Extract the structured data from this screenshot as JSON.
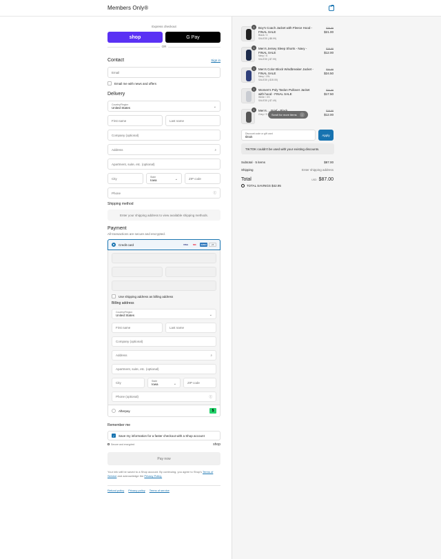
{
  "header": {
    "brand": "Members Only®"
  },
  "express": {
    "label": "Express checkout",
    "shop_pay": "shop",
    "gpay": "G Pay",
    "or": "OR"
  },
  "contact": {
    "heading": "Contact",
    "sign_in": "Sign in",
    "email_placeholder": "Email",
    "news_label": "Email me with news and offers"
  },
  "delivery": {
    "heading": "Delivery",
    "country_label": "Country/Region",
    "country_value": "United States",
    "first_name": "First name",
    "last_name": "Last name",
    "company": "Company (optional)",
    "address": "Address",
    "apartment": "Apartment, suite, etc. (optional)",
    "city": "City",
    "state_label": "State",
    "state_value": "Iowa",
    "zip": "ZIP code",
    "phone": "Phone"
  },
  "shipping": {
    "heading": "Shipping method",
    "notice": "Enter your shipping address to view available shipping methods."
  },
  "payment": {
    "heading": "Payment",
    "note": "All transactions are secure and encrypted.",
    "credit_card": "Credit card",
    "cards": [
      "VISA",
      "MC",
      "AMEX",
      "+5"
    ],
    "use_shipping": "Use shipping address as billing address",
    "billing_heading": "Billing address",
    "afterpay": "Afterpay"
  },
  "remember": {
    "heading": "Remember me",
    "save_label": "Save my information for a faster checkout with a Shop account",
    "secure": "Secure and encrypted",
    "shop": "shop"
  },
  "pay_now": "Pay now",
  "terms": {
    "text": "Your info will be saved to a Shop account. By continuing, you agree to Shop's",
    "tos": "Terms of Service",
    "mid": "and acknowledge the",
    "privacy": "Privacy Policy."
  },
  "footer": {
    "links": [
      "Refund policy",
      "Privacy policy",
      "Terms of service"
    ]
  },
  "cart": {
    "items": [
      {
        "qty": "1",
        "name": "Boy's Coach Jacket with Fleece Hood - FINAL SALE",
        "variant": "Black / 4",
        "discount": "SALE30 (-$8.99)",
        "original": "$29.99",
        "price": "$21.00",
        "color": "#222"
      },
      {
        "qty": "1",
        "name": "Men's Jersey Sleep Shorts - Navy - FINAL SALE",
        "variant": "Navy / S",
        "discount": "SALE30 (-$7.99)",
        "original": "$19.99",
        "price": "$12.00",
        "color": "#1d2b4a"
      },
      {
        "qty": "1",
        "name": "Men's Color Block Windbreaker Jacket - FINAL SALE",
        "variant": "Navy / 2XL",
        "discount": "SALE30 (-$15.00)",
        "original": "$34.99",
        "price": "$24.50",
        "color": "#2f3f7a"
      },
      {
        "qty": "1",
        "name": "Women's Poly Taslon Pullover Jacket with hood - FINAL SALE",
        "variant": "White / XS",
        "discount": "SALE30 (-$7.49)",
        "original": "$24.99",
        "price": "$17.50",
        "color": "#c9ccd2"
      },
      {
        "qty": "1",
        "name": "Men's ... Brief - Black",
        "variant": "Grey / S",
        "discount": "",
        "original": "$19.99",
        "price": "$12.00",
        "color": "#555"
      }
    ],
    "scroll_pill": "Scroll for more items",
    "discount_label": "Discount code or gift card",
    "discount_value": "tiktok",
    "apply": "Apply",
    "error": "TIKTOK couldn't be used with your existing discounts.",
    "subtotal_label": "Subtotal · 5 items",
    "subtotal": "$87.00",
    "shipping_label": "Shipping",
    "shipping": "Enter shipping address",
    "total_label": "Total",
    "currency": "USD",
    "total": "$87.00",
    "savings": "TOTAL SAVINGS  $42.95"
  }
}
